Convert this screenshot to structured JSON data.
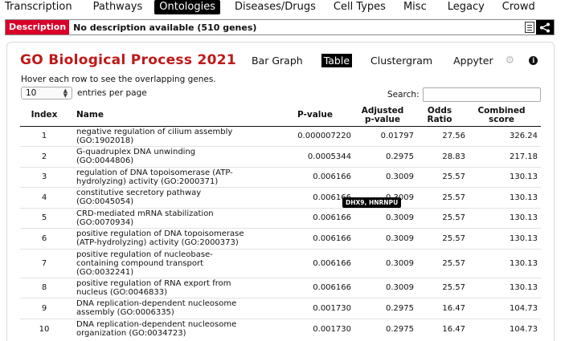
{
  "nav": {
    "tabs": [
      {
        "label": "Transcription",
        "active": false
      },
      {
        "label": "Pathways",
        "active": false
      },
      {
        "label": "Ontologies",
        "active": true
      },
      {
        "label": "Diseases/Drugs",
        "active": false
      },
      {
        "label": "Cell Types",
        "active": false
      },
      {
        "label": "Misc",
        "active": false
      },
      {
        "label": "Legacy",
        "active": false
      },
      {
        "label": "Crowd",
        "active": false
      }
    ]
  },
  "description": {
    "label": "Description",
    "text": "No description available (510 genes)"
  },
  "panel": {
    "title": "GO Biological Process 2021",
    "tabs": [
      {
        "label": "Bar Graph",
        "active": false
      },
      {
        "label": "Table",
        "active": true
      },
      {
        "label": "Clustergram",
        "active": false
      },
      {
        "label": "Appyter",
        "active": false
      }
    ],
    "hint": "Hover each row to see the overlapping genes.",
    "entries_value": "10",
    "entries_label": "entries per page",
    "search_label": "Search:",
    "search_value": ""
  },
  "table": {
    "columns": {
      "index": "Index",
      "name": "Name",
      "pvalue": "P-value",
      "adj_line1": "Adjusted",
      "adj_line2": "p-value",
      "odds_line1": "Odds",
      "odds_line2": "Ratio",
      "comb_line1": "Combined",
      "comb_line2": "score"
    },
    "rows": [
      {
        "index": "1",
        "name1": "negative regulation of cilium assembly",
        "name2": "(GO:1902018)",
        "pvalue": "0.000007220",
        "adj": "0.01797",
        "odds": "27.56",
        "comb": "326.24"
      },
      {
        "index": "2",
        "name1": "G-quadruplex DNA unwinding",
        "name2": "(GO:0044806)",
        "pvalue": "0.0005344",
        "adj": "0.2975",
        "odds": "28.83",
        "comb": "217.18"
      },
      {
        "index": "3",
        "name1": "regulation of DNA topoisomerase (ATP-",
        "name2": "hydrolyzing) activity (GO:2000371)",
        "pvalue": "0.006166",
        "adj": "0.3009",
        "odds": "25.57",
        "comb": "130.13"
      },
      {
        "index": "4",
        "name1": "constitutive secretory pathway",
        "name2": "(GO:0045054)",
        "pvalue": "0.006166",
        "adj": "0.3009",
        "odds": "25.57",
        "comb": "130.13"
      },
      {
        "index": "5",
        "name1": "CRD-mediated mRNA stabilization",
        "name2": "(GO:0070934)",
        "pvalue": "0.006166",
        "adj": "0.3009",
        "odds": "25.57",
        "comb": "130.13"
      },
      {
        "index": "6",
        "name1": "positive regulation of DNA topoisomerase",
        "name2": "(ATP-hydrolyzing) activity (GO:2000373)",
        "pvalue": "0.006166",
        "adj": "0.3009",
        "odds": "25.57",
        "comb": "130.13"
      },
      {
        "index": "7",
        "name1": "positive regulation of nucleobase-",
        "name2": "containing compound transport",
        "name3": "(GO:0032241)",
        "pvalue": "0.006166",
        "adj": "0.3009",
        "odds": "25.57",
        "comb": "130.13"
      },
      {
        "index": "8",
        "name1": "positive regulation of RNA export from",
        "name2": "nucleus (GO:0046833)",
        "pvalue": "0.006166",
        "adj": "0.3009",
        "odds": "25.57",
        "comb": "130.13"
      },
      {
        "index": "9",
        "name1": "DNA replication-dependent nucleosome",
        "name2": "assembly (GO:0006335)",
        "pvalue": "0.001730",
        "adj": "0.2975",
        "odds": "16.47",
        "comb": "104.73"
      },
      {
        "index": "10",
        "name1": "DNA replication-dependent nucleosome",
        "name2": "organization (GO:0034723)",
        "pvalue": "0.001730",
        "adj": "0.2975",
        "odds": "16.47",
        "comb": "104.73"
      }
    ]
  },
  "tooltip": "DHX9, HNRNPU",
  "colors": {
    "accent_red": "#d9002a",
    "title_red": "#c01818",
    "active_tab_bg": "#000000"
  }
}
